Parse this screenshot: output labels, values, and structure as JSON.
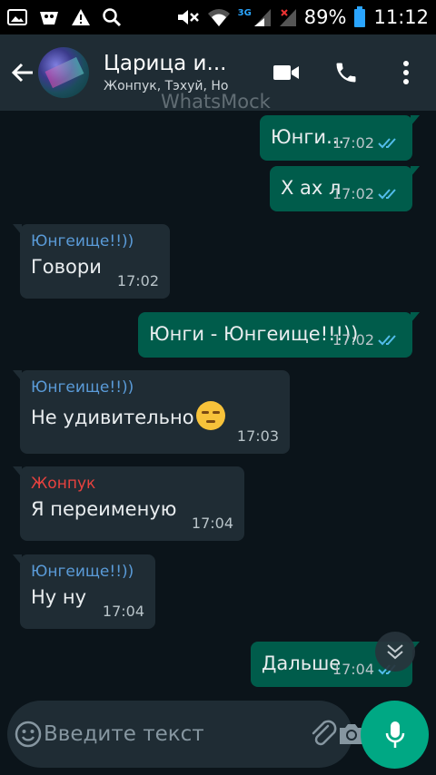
{
  "status_bar": {
    "icons": [
      "image-icon",
      "app-icon",
      "warning-icon",
      "search-icon",
      "mute-icon",
      "wifi-icon",
      "signal-icon",
      "signal-off-icon",
      "battery-icon"
    ],
    "network": "3G",
    "battery": "89%",
    "time": "11:12"
  },
  "header": {
    "title": "Царица и...",
    "subtitle": "Жонпук, Тэхуй, Но",
    "watermark": "WhatsMock"
  },
  "messages": [
    {
      "dir": "out",
      "text": "Юнги...",
      "time": "17:02",
      "read": true
    },
    {
      "dir": "out",
      "text": "Х ах л",
      "time": "17:02",
      "read": true
    },
    {
      "dir": "in",
      "sender": "Юнгеище!!))",
      "text": "Говори",
      "time": "17:02"
    },
    {
      "dir": "out",
      "text": "Юнги - Юнгеище!!!))",
      "time": "17:02",
      "read": true
    },
    {
      "dir": "in",
      "sender": "Юнгеище!!))",
      "text": "Не удивительно",
      "time": "17:03",
      "emoji": "unamused-face"
    },
    {
      "dir": "in",
      "sender": "Жонпук",
      "text": "Я переименую",
      "time": "17:04"
    },
    {
      "dir": "in",
      "sender": "Юнгеище!!))",
      "text": "Ну ну",
      "time": "17:04"
    },
    {
      "dir": "out",
      "text": "Дальше",
      "time": "17:04",
      "read": true
    }
  ],
  "composer": {
    "placeholder": "Введите текст",
    "value": ""
  },
  "colors": {
    "header_bg": "#1f2c34",
    "outgoing_bubble": "#005c4b",
    "incoming_bubble": "#1f2c34",
    "sender_blue": "#5a9bd8",
    "sender_red": "#e8423f",
    "read_ticks": "#53bdeb",
    "mic_button": "#00a884"
  }
}
